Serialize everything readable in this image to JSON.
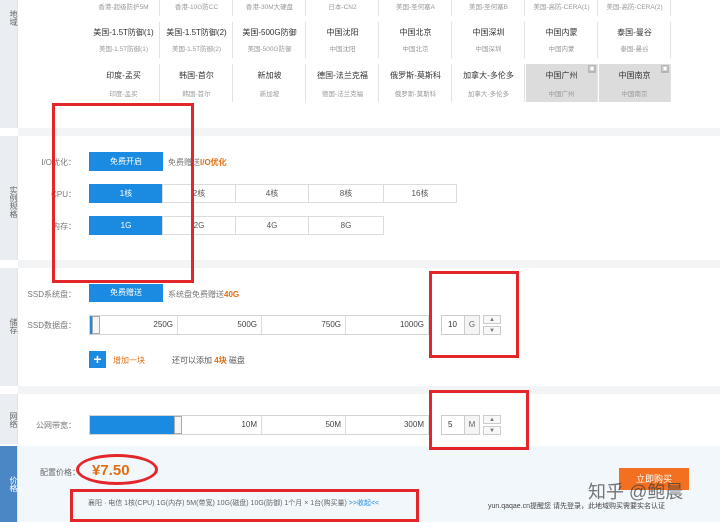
{
  "sections": {
    "region": "地域",
    "spec": "实例规格",
    "storage": "储存",
    "network": "网络",
    "price": "价格"
  },
  "regions": {
    "row0": [
      "香港-超级防护5M",
      "香港-10G防CC",
      "香港-30M大硬盘",
      "日本-CN2",
      "美国-圣何塞A",
      "美国-圣何塞B",
      "美国-高防-CERA(1)",
      "美国-高防-CERA(2)"
    ],
    "row1": [
      {
        "name": "美国-1.5T防御(1)",
        "sub": "美国-1.5T防御(1)"
      },
      {
        "name": "美国-1.5T防御(2)",
        "sub": "美国-1.5T防御(2)"
      },
      {
        "name": "美国-500G防御",
        "sub": "美国-500G防御"
      },
      {
        "name": "中国沈阳",
        "sub": "中国沈阳"
      },
      {
        "name": "中国北京",
        "sub": "中国北京"
      },
      {
        "name": "中国深圳",
        "sub": "中国深圳"
      },
      {
        "name": "中国内蒙",
        "sub": "中国内蒙"
      },
      {
        "name": "泰国-曼谷",
        "sub": "泰国-曼谷"
      }
    ],
    "row2": [
      {
        "name": "印度-孟买",
        "sub": "印度-孟买"
      },
      {
        "name": "韩国-首尔",
        "sub": "韩国-首尔"
      },
      {
        "name": "新加坡",
        "sub": "新加坡"
      },
      {
        "name": "德国-法兰克福",
        "sub": "德国-法兰克福"
      },
      {
        "name": "俄罗斯-莫斯科",
        "sub": "俄罗斯-莫斯科"
      },
      {
        "name": "加拿大-多伦多",
        "sub": "加拿大-多伦多"
      },
      {
        "name": "中国广州",
        "sub": "中国广州"
      },
      {
        "name": "中国南京",
        "sub": "中国南京"
      }
    ]
  },
  "spec": {
    "io_label": "I/O优化：",
    "io_button": "免费开启",
    "io_note_prefix": "免费赠送",
    "io_note_accent": "I/O优化",
    "cpu_label": "CPU：",
    "cpu_options": [
      "1核",
      "2核",
      "4核",
      "8核",
      "16核"
    ],
    "ram_label": "内存：",
    "ram_options": [
      "1G",
      "2G",
      "4G",
      "8G"
    ]
  },
  "storage": {
    "ssd_system_label": "SSD系统盘：",
    "ssd_system_button": "免费赠送",
    "ssd_system_note": "系统盘免费赠送",
    "ssd_system_note_accent": "40G",
    "ssd_data_label": "SSD数据盘：",
    "ticks": [
      "250G",
      "500G",
      "750G",
      "1000G"
    ],
    "value": "10",
    "unit": "G",
    "slider_fraction": 0.01,
    "add_label": "增加一块",
    "remaining_prefix": "还可以添加",
    "remaining_accent": "4块",
    "remaining_suffix": "磁盘"
  },
  "network": {
    "bandwidth_label": "公网带宽：",
    "ticks": [
      "10M",
      "50M",
      "300M"
    ],
    "value": "5",
    "unit": "M",
    "slider_fraction": 0.02
  },
  "price": {
    "label": "配置价格：",
    "amount": "¥7.50",
    "summary": "襄阳 · 电信 1核(CPU) 1G(内存) 5M(带宽) 10G(磁盘) 10G(防御) 1个月 × 1台(购买量)",
    "collapse_link": ">>收起<<",
    "buy_button": "立即购买",
    "footer_note": "yun.qaqae.cn提醒您 请先登录，此地域购买需要实名认证",
    "watermark": "知乎 @鲍晨"
  },
  "colors": {
    "accent": "#1a8be0",
    "highlight": "#e06e10",
    "annotation": "#e3262a"
  }
}
